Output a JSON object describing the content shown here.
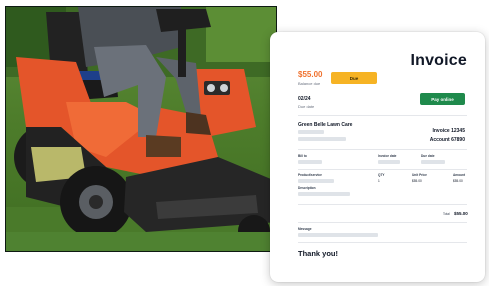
{
  "invoice": {
    "title": "Invoice",
    "amount": "$55.00",
    "amount_label": "Balance due",
    "due_button_label": "Due",
    "date": "02/24",
    "date_label": "Due date",
    "pay_button_label": "Pay online",
    "company_name": "Green Belle Lawn Care",
    "invoice_number": "Invoice 12345",
    "account_number": "Account 67890",
    "fields": {
      "col1_label": "Bill to",
      "col2_label": "Invoice date",
      "col3_label": "Due date"
    },
    "table": {
      "headers": [
        "Product/service",
        "QTY",
        "Unit Price",
        "Amount"
      ],
      "rows": [
        {
          "qty": "1",
          "unit_price": "$55.00",
          "amount": "$55.00"
        }
      ],
      "description_label": "Description"
    },
    "total_label": "Total",
    "total_value": "$55.00",
    "message_label": "Message",
    "thanks": "Thank you!"
  },
  "colors": {
    "amount": "#f0722f",
    "due_button": "#f6b324",
    "pay_button": "#1f8a4c",
    "mower_orange": "#e4552a"
  }
}
